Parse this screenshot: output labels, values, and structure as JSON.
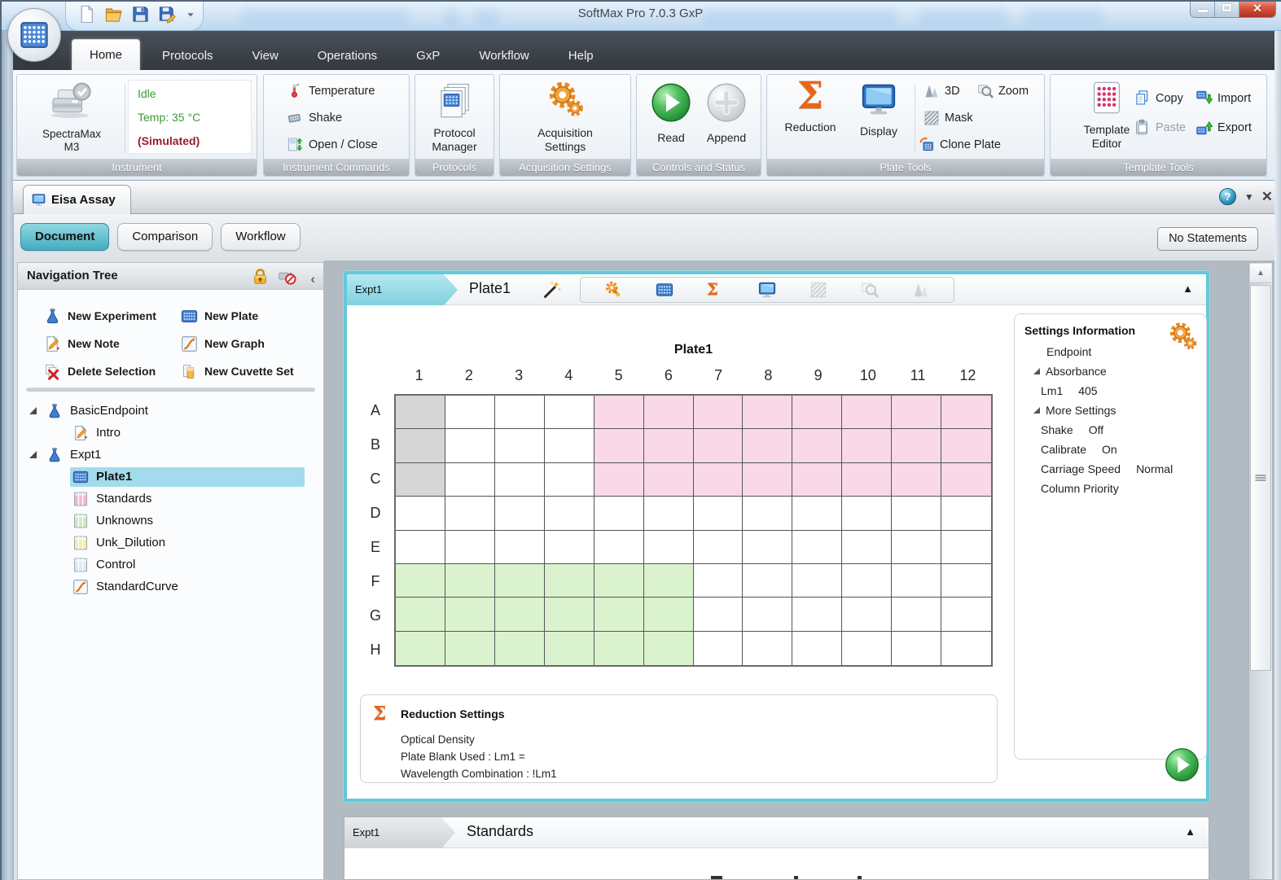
{
  "titlebar": {
    "title": "SoftMax Pro 7.0.3 GxP",
    "quick_access": [
      {
        "name": "new-document",
        "icon": "doc-new"
      },
      {
        "name": "open-file",
        "icon": "folder-open"
      },
      {
        "name": "save",
        "icon": "save"
      },
      {
        "name": "save-as",
        "icon": "save-as"
      }
    ]
  },
  "ribbon_tabs": [
    {
      "label": "Home",
      "active": true
    },
    {
      "label": "Protocols",
      "active": false
    },
    {
      "label": "View",
      "active": false
    },
    {
      "label": "Operations",
      "active": false
    },
    {
      "label": "GxP",
      "active": false
    },
    {
      "label": "Workflow",
      "active": false
    },
    {
      "label": "Help",
      "active": false
    }
  ],
  "ribbon": {
    "instrument": {
      "group_label": "Instrument",
      "device_name": "SpectraMax M3",
      "status_state": "Idle",
      "status_temp": "Temp: 35 °C",
      "status_mode": "(Simulated)"
    },
    "instrument_commands": {
      "group_label": "Instrument Commands",
      "items": [
        {
          "label": "Temperature",
          "icon": "thermometer",
          "name": "temperature-button"
        },
        {
          "label": "Shake",
          "icon": "shake",
          "name": "shake-button"
        },
        {
          "label": "Open / Close",
          "icon": "open-close",
          "name": "open-close-button"
        }
      ]
    },
    "protocols": {
      "group_label": "Protocols",
      "button_label": "Protocol Manager"
    },
    "acquisition": {
      "group_label": "Acquisition Settings",
      "button_label": "Acquisition Settings"
    },
    "controls": {
      "group_label": "Controls and Status",
      "buttons": [
        {
          "label": "Read",
          "icon": "play-green",
          "name": "read-button",
          "enabled": true
        },
        {
          "label": "Append",
          "icon": "plus-gray",
          "name": "append-button",
          "enabled": false
        }
      ]
    },
    "plate_tools": {
      "group_label": "Plate Tools",
      "reduction_label": "Reduction",
      "display_label": "Display",
      "small_buttons": [
        {
          "label": "3D",
          "icon": "cones-3d",
          "name": "3d-button",
          "enabled": true
        },
        {
          "label": "Zoom",
          "icon": "zoom-mag",
          "name": "zoom-button",
          "enabled": true
        },
        {
          "label": "Mask",
          "icon": "mask",
          "name": "mask-button",
          "enabled": true
        },
        {
          "label": "Clone Plate",
          "icon": "clone-plate",
          "name": "clone-plate-button",
          "enabled": true
        }
      ]
    },
    "template_tools": {
      "group_label": "Template Tools",
      "editor_label": "Template Editor",
      "small_buttons": [
        {
          "label": "Copy",
          "icon": "copy",
          "name": "copy-button",
          "enabled": true
        },
        {
          "label": "Paste",
          "icon": "paste",
          "name": "paste-button",
          "enabled": false
        },
        {
          "label": "Import",
          "icon": "import",
          "name": "import-button",
          "enabled": true
        },
        {
          "label": "Export",
          "icon": "export",
          "name": "export-button",
          "enabled": true
        }
      ]
    }
  },
  "document_tab": {
    "label": "Eisa Assay"
  },
  "view_tabs": [
    {
      "label": "Document",
      "active": true
    },
    {
      "label": "Comparison",
      "active": false
    },
    {
      "label": "Workflow",
      "active": false
    }
  ],
  "statements_button": "No Statements",
  "sidebar": {
    "title": "Navigation Tree",
    "actions": [
      {
        "label": "New Experiment",
        "icon": "flask",
        "name": "new-experiment-button"
      },
      {
        "label": "New Plate",
        "icon": "plate",
        "name": "new-plate-button"
      },
      {
        "label": "New Note",
        "icon": "note",
        "name": "new-note-button"
      },
      {
        "label": "New Graph",
        "icon": "graph",
        "name": "new-graph-button"
      },
      {
        "label": "Delete Selection",
        "icon": "delete",
        "name": "delete-selection-button"
      },
      {
        "label": "New Cuvette Set",
        "icon": "cuvette",
        "name": "new-cuvette-set-button"
      }
    ],
    "tree": [
      {
        "label": "BasicEndpoint",
        "icon": "flask",
        "level": 0,
        "expanded": true,
        "selected": false
      },
      {
        "label": "Intro",
        "icon": "note",
        "level": 1,
        "selected": false
      },
      {
        "label": "Expt1",
        "icon": "flask",
        "level": 0,
        "expanded": true,
        "selected": false
      },
      {
        "label": "Plate1",
        "icon": "plate",
        "level": 1,
        "selected": true
      },
      {
        "label": "Standards",
        "icon": "group-pink",
        "level": 1,
        "selected": false
      },
      {
        "label": "Unknowns",
        "icon": "group-green",
        "level": 1,
        "selected": false
      },
      {
        "label": "Unk_Dilution",
        "icon": "group-yellow",
        "level": 1,
        "selected": false
      },
      {
        "label": "Control",
        "icon": "group-blue",
        "level": 1,
        "selected": false
      },
      {
        "label": "StandardCurve",
        "icon": "graph",
        "level": 1,
        "selected": false
      }
    ]
  },
  "plate_section": {
    "exp_tab": "Expt1",
    "title": "Plate1",
    "toolbar": [
      {
        "name": "acquisition-settings",
        "icon": "acq-mag",
        "enabled": true
      },
      {
        "name": "template-editor",
        "icon": "plate",
        "enabled": true
      },
      {
        "name": "reduction",
        "icon": "sigma",
        "enabled": true
      },
      {
        "name": "display",
        "icon": "monitor",
        "enabled": true
      },
      {
        "name": "mask",
        "icon": "mask",
        "enabled": false
      },
      {
        "name": "zoom",
        "icon": "zoom-mag",
        "enabled": false
      },
      {
        "name": "three-d",
        "icon": "cones-3d",
        "enabled": false
      }
    ]
  },
  "plate": {
    "title": "Plate1",
    "columns": [
      "1",
      "2",
      "3",
      "4",
      "5",
      "6",
      "7",
      "8",
      "9",
      "10",
      "11",
      "12"
    ],
    "rows": [
      "A",
      "B",
      "C",
      "D",
      "E",
      "F",
      "G",
      "H"
    ],
    "well_groups": [
      {
        "name": "blank-wells",
        "color": "#d6d6d6",
        "range": "A1:C1"
      },
      {
        "name": "standard-wells",
        "color": "#f9d9e8",
        "range": "A5:C12"
      },
      {
        "name": "unknown-wells",
        "color": "#dbf2cf",
        "range": "F1:H6"
      }
    ]
  },
  "settings_panel": {
    "title": "Settings Information",
    "rows": [
      {
        "text": "Endpoint",
        "indent": 2
      },
      {
        "text": "Absorbance",
        "expander": true
      },
      {
        "label": "Lm1",
        "value": "405",
        "indent": 1
      },
      {
        "text": "More Settings",
        "expander": true
      },
      {
        "label": "Shake",
        "value": "Off",
        "indent": 1
      },
      {
        "label": "Calibrate",
        "value": "On",
        "indent": 1
      },
      {
        "label": "Carriage Speed",
        "value": "Normal",
        "indent": 1
      },
      {
        "label": "Column Priority",
        "value": "",
        "indent": 1
      }
    ]
  },
  "reduction_panel": {
    "title": "Reduction Settings",
    "lines": [
      "Optical Density",
      "Plate Blank Used : Lm1 =",
      "Wavelength Combination : !Lm1"
    ]
  },
  "standards_section": {
    "exp_tab": "Expt1",
    "title": "Standards"
  }
}
